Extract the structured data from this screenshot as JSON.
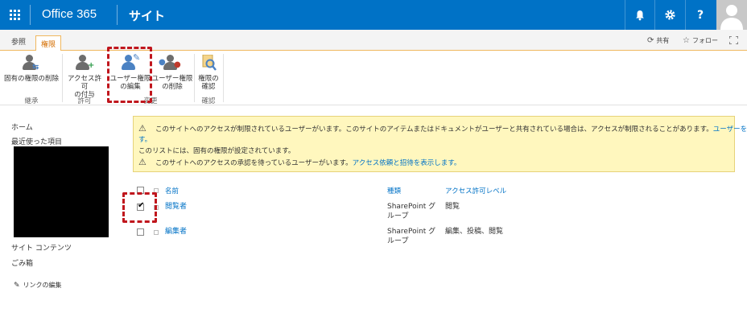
{
  "suite": {
    "brand": "Office 365",
    "site": "サイト",
    "icons": [
      "bell-icon",
      "gear-icon",
      "help-icon",
      "avatar"
    ]
  },
  "tabs": {
    "browse": "参照",
    "permissions": "権限",
    "share": "共有",
    "follow": "フォロー"
  },
  "ribbon": {
    "delete_unique": "固有の権限の削除",
    "grant_line1": "アクセス許可",
    "grant_line2": "の付与",
    "edit_line1": "ユーザー権限",
    "edit_line2": "の編集",
    "remove_line1": "ユーザー権限",
    "remove_line2": "の削除",
    "check_line1": "権限の",
    "check_line2": "確認",
    "group_inherit": "継承",
    "group_grant": "許可",
    "group_modify": "変更",
    "group_check": "確認"
  },
  "leftnav": {
    "home": "ホーム",
    "recent": "最近使った項目",
    "site_contents": "サイト コンテンツ",
    "recycle_bin": "ごみ箱",
    "edit_links": "リンクの編集"
  },
  "warning": {
    "line1": "このサイトへのアクセスが制限されているユーザーがいます。このサイトのアイテムまたはドキュメントがユーザーと共有されている場合は、アクセスが制限されることがあります。",
    "line1_link": "ユーザーを表示しま",
    "line1_cont": "す。",
    "line2": "このリストには、固有の権限が設定されています。",
    "line3": "このサイトへのアクセスの承認を待っているユーザーがいます。",
    "line3_link": "アクセス依頼と招待を表示します。"
  },
  "list": {
    "headers": {
      "name": "名前",
      "type": "種類",
      "level": "アクセス許可レベル"
    },
    "rows": [
      {
        "name": "閲覧者",
        "type_line1": "SharePoint グ",
        "type_line2": "ループ",
        "level": "閲覧",
        "checked": true
      },
      {
        "name": "編集者",
        "type_line1": "SharePoint グ",
        "type_line2": "ループ",
        "level": "編集、投稿、閲覧",
        "checked": false
      }
    ]
  },
  "colors": {
    "suite_bar": "#0072c6",
    "accent_tab": "#d46e00",
    "highlight": "#c0161d",
    "warning_bg": "#fff7be"
  }
}
